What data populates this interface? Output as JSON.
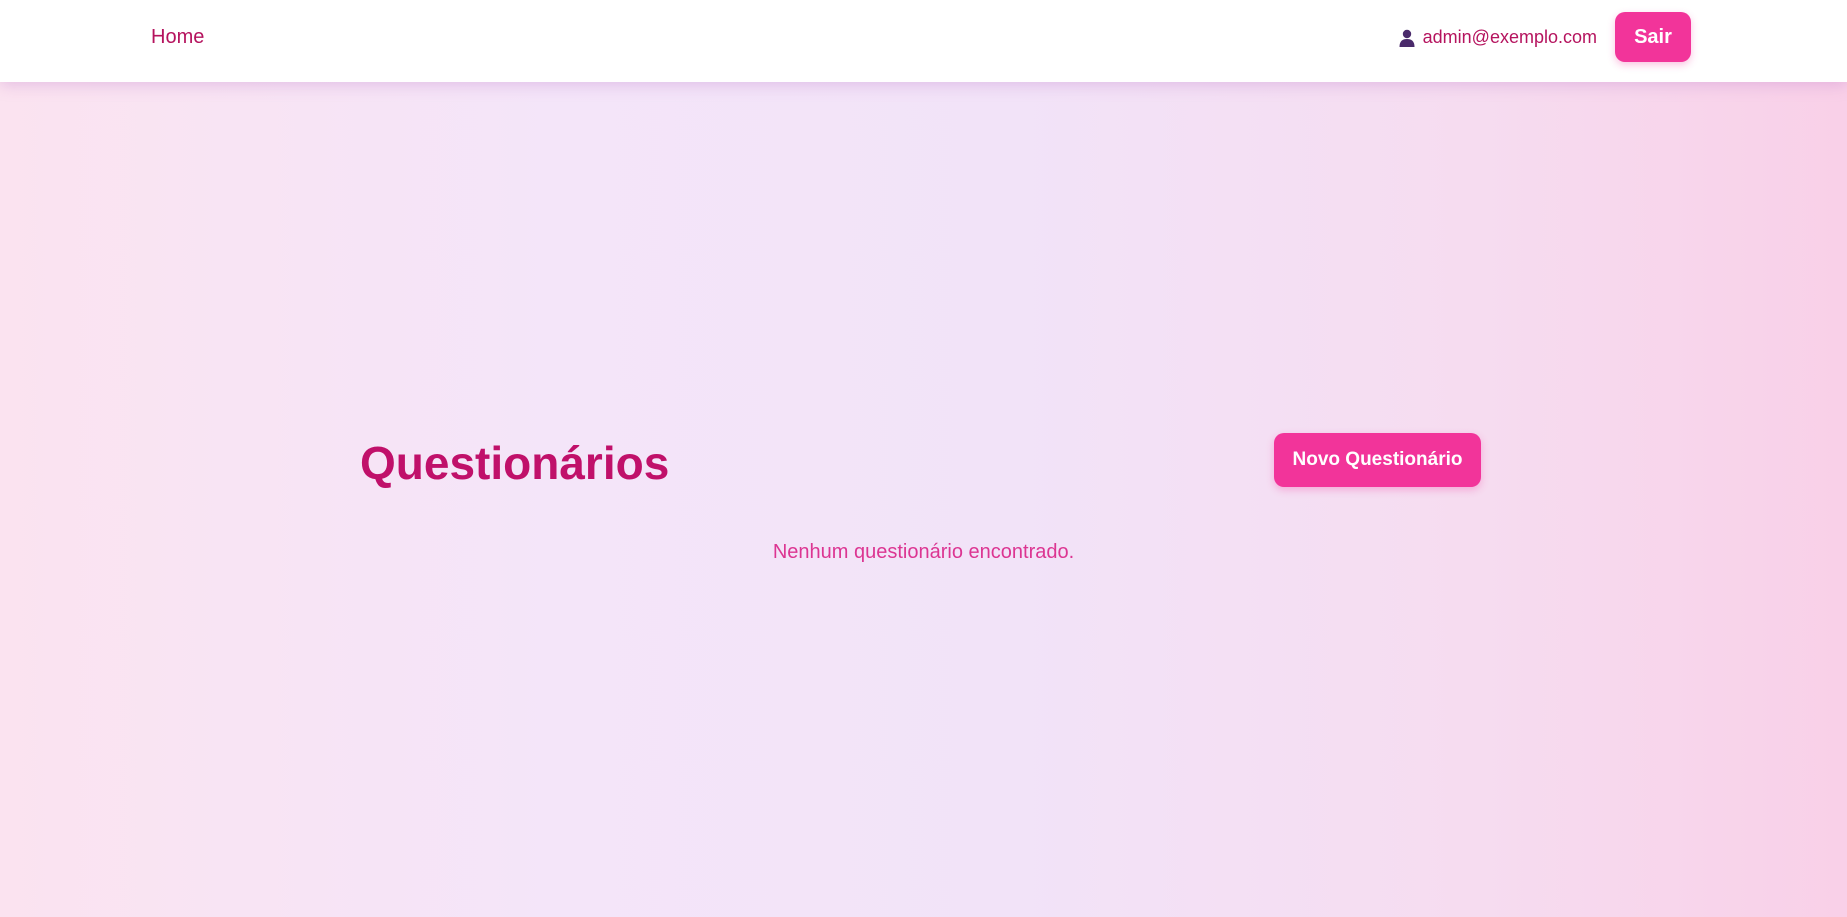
{
  "nav": {
    "home_label": "Home",
    "user_email": "admin@exemplo.com",
    "logout_label": "Sair"
  },
  "main": {
    "title": "Questionários",
    "new_button_label": "Novo Questionário",
    "empty_message": "Nenhum questionário encontrado."
  },
  "icons": {
    "user": "user-icon"
  },
  "colors": {
    "accent": "#f2349a",
    "title": "#c0106a",
    "link": "#b5135e",
    "empty_text": "#dc3592",
    "user_icon": "#4a2a6b"
  }
}
